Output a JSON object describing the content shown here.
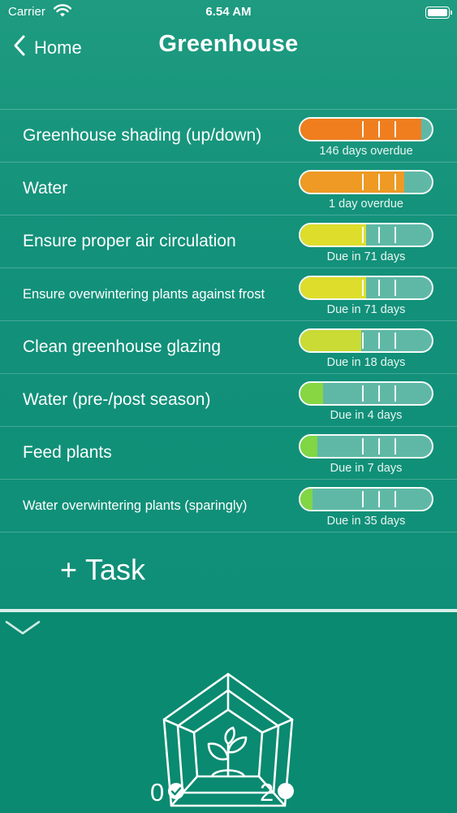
{
  "status_bar": {
    "carrier": "Carrier",
    "time": "6.54 AM"
  },
  "nav": {
    "back_label": "Home",
    "title": "Greenhouse"
  },
  "tasks": [
    {
      "label": "Greenhouse shading (up/down)",
      "status": "146 days overdue",
      "level": 0.92,
      "color": "#f07e1e",
      "size": "big"
    },
    {
      "label": "Water",
      "status": "1 day overdue",
      "level": 0.79,
      "color": "#ee9a24",
      "size": "big"
    },
    {
      "label": "Ensure proper air circulation",
      "status": "Due in 71 days",
      "level": 0.5,
      "color": "#dedd2c",
      "size": "big"
    },
    {
      "label": "Ensure overwintering plants against frost",
      "status": "Due in 71 days",
      "level": 0.5,
      "color": "#dedd2c",
      "size": "small"
    },
    {
      "label": "Clean greenhouse glazing",
      "status": "Due in 18 days",
      "level": 0.46,
      "color": "#c9db34",
      "size": "big"
    },
    {
      "label": "Water (pre-/post season)",
      "status": "Due in 4 days",
      "level": 0.17,
      "color": "#87d642",
      "size": "big"
    },
    {
      "label": "Feed plants",
      "status": "Due in 7 days",
      "level": 0.13,
      "color": "#80d644",
      "size": "big"
    },
    {
      "label": "Water overwintering plants (sparingly)",
      "status": "Due in 35 days",
      "level": 0.09,
      "color": "#80d644",
      "size": "small"
    }
  ],
  "add_task": {
    "plus": "+",
    "label": "Task"
  },
  "counters": {
    "done": "0",
    "pending": "2"
  },
  "icons": {
    "back": "chevron-left-icon",
    "collapse": "chevron-down-icon",
    "place": "greenhouse-plant-icon",
    "done": "check-circle-icon",
    "pending": "filled-circle-icon"
  }
}
